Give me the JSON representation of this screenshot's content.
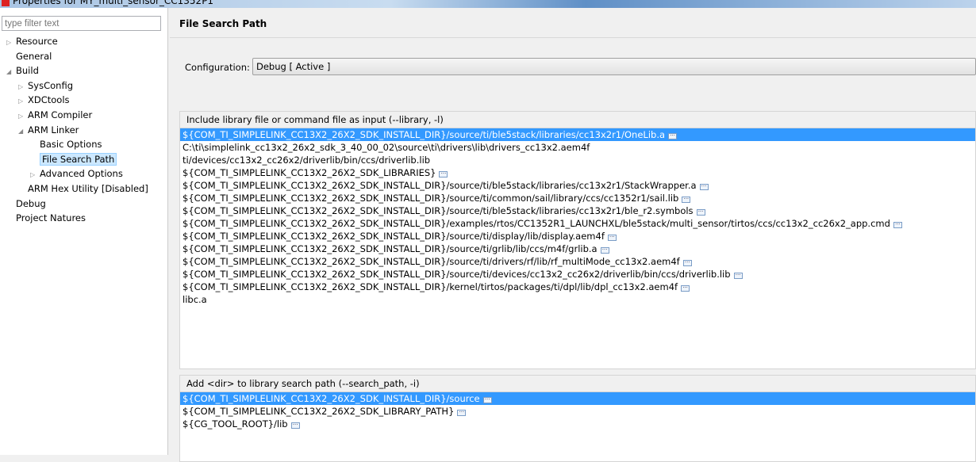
{
  "window": {
    "title": "Properties for MY_multi_sensor_CC1352P1"
  },
  "filter": {
    "placeholder": "type filter text"
  },
  "tree": [
    {
      "label": "Resource",
      "indent": 0,
      "twisty": "collapsed"
    },
    {
      "label": "General",
      "indent": 0,
      "twisty": "none"
    },
    {
      "label": "Build",
      "indent": 0,
      "twisty": "expanded"
    },
    {
      "label": "SysConfig",
      "indent": 1,
      "twisty": "collapsed"
    },
    {
      "label": "XDCtools",
      "indent": 1,
      "twisty": "collapsed"
    },
    {
      "label": "ARM Compiler",
      "indent": 1,
      "twisty": "collapsed"
    },
    {
      "label": "ARM Linker",
      "indent": 1,
      "twisty": "expanded"
    },
    {
      "label": "Basic Options",
      "indent": 2,
      "twisty": "none"
    },
    {
      "label": "File Search Path",
      "indent": 2,
      "twisty": "none",
      "selected": true
    },
    {
      "label": "Advanced Options",
      "indent": 2,
      "twisty": "collapsed"
    },
    {
      "label": "ARM Hex Utility  [Disabled]",
      "indent": 1,
      "twisty": "none"
    },
    {
      "label": "Debug",
      "indent": 0,
      "twisty": "none"
    },
    {
      "label": "Project Natures",
      "indent": 0,
      "twisty": "none"
    }
  ],
  "page": {
    "title": "File Search Path",
    "config_label": "Configuration:",
    "config_value": "Debug  [ Active ]"
  },
  "include": {
    "label": "Include library file or command file as input (--library, -l)",
    "items": [
      {
        "text": "${COM_TI_SIMPLELINK_CC13X2_26X2_SDK_INSTALL_DIR}/source/ti/ble5stack/libraries/cc13x2r1/OneLib.a",
        "icon": true,
        "selected": true
      },
      {
        "text": "C:\\ti\\simplelink_cc13x2_26x2_sdk_3_40_00_02\\source\\ti\\drivers\\lib\\drivers_cc13x2.aem4f",
        "icon": false
      },
      {
        "text": "ti/devices/cc13x2_cc26x2/driverlib/bin/ccs/driverlib.lib",
        "icon": false
      },
      {
        "text": "${COM_TI_SIMPLELINK_CC13X2_26X2_SDK_LIBRARIES}",
        "icon": true
      },
      {
        "text": "${COM_TI_SIMPLELINK_CC13X2_26X2_SDK_INSTALL_DIR}/source/ti/ble5stack/libraries/cc13x2r1/StackWrapper.a",
        "icon": true
      },
      {
        "text": "${COM_TI_SIMPLELINK_CC13X2_26X2_SDK_INSTALL_DIR}/source/ti/common/sail/library/ccs/cc1352r1/sail.lib",
        "icon": true
      },
      {
        "text": "${COM_TI_SIMPLELINK_CC13X2_26X2_SDK_INSTALL_DIR}/source/ti/ble5stack/libraries/cc13x2r1/ble_r2.symbols",
        "icon": true
      },
      {
        "text": "${COM_TI_SIMPLELINK_CC13X2_26X2_SDK_INSTALL_DIR}/examples/rtos/CC1352R1_LAUNCHXL/ble5stack/multi_sensor/tirtos/ccs/cc13x2_cc26x2_app.cmd",
        "icon": true
      },
      {
        "text": "${COM_TI_SIMPLELINK_CC13X2_26X2_SDK_INSTALL_DIR}/source/ti/display/lib/display.aem4f",
        "icon": true
      },
      {
        "text": "${COM_TI_SIMPLELINK_CC13X2_26X2_SDK_INSTALL_DIR}/source/ti/grlib/lib/ccs/m4f/grlib.a",
        "icon": true
      },
      {
        "text": "${COM_TI_SIMPLELINK_CC13X2_26X2_SDK_INSTALL_DIR}/source/ti/drivers/rf/lib/rf_multiMode_cc13x2.aem4f",
        "icon": true
      },
      {
        "text": "${COM_TI_SIMPLELINK_CC13X2_26X2_SDK_INSTALL_DIR}/source/ti/devices/cc13x2_cc26x2/driverlib/bin/ccs/driverlib.lib",
        "icon": true
      },
      {
        "text": "${COM_TI_SIMPLELINK_CC13X2_26X2_SDK_INSTALL_DIR}/kernel/tirtos/packages/ti/dpl/lib/dpl_cc13x2.aem4f",
        "icon": true
      },
      {
        "text": "libc.a",
        "icon": false
      }
    ]
  },
  "search": {
    "label": "Add <dir> to library search path (--search_path, -i)",
    "items": [
      {
        "text": "${COM_TI_SIMPLELINK_CC13X2_26X2_SDK_INSTALL_DIR}/source",
        "icon": true,
        "selected": true
      },
      {
        "text": "${COM_TI_SIMPLELINK_CC13X2_26X2_SDK_LIBRARY_PATH}",
        "icon": true
      },
      {
        "text": "${CG_TOOL_ROOT}/lib",
        "icon": true
      }
    ]
  }
}
